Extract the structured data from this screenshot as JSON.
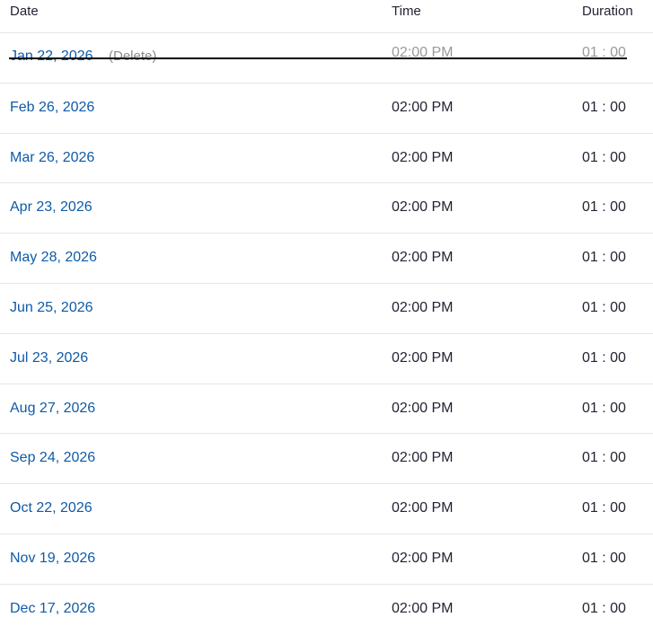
{
  "header": {
    "date": "Date",
    "time": "Time",
    "duration": "Duration"
  },
  "deleted_row": {
    "date": "Jan 22, 2026",
    "note": "(Delete)",
    "time": "02:00 PM",
    "duration": "01 : 00"
  },
  "rows": [
    {
      "date": "Feb 26, 2026",
      "time": "02:00 PM",
      "duration": "01 : 00"
    },
    {
      "date": "Mar 26, 2026",
      "time": "02:00 PM",
      "duration": "01 : 00"
    },
    {
      "date": "Apr 23, 2026",
      "time": "02:00 PM",
      "duration": "01 : 00"
    },
    {
      "date": "May 28, 2026",
      "time": "02:00 PM",
      "duration": "01 : 00"
    },
    {
      "date": "Jun 25, 2026",
      "time": "02:00 PM",
      "duration": "01 : 00"
    },
    {
      "date": "Jul 23, 2026",
      "time": "02:00 PM",
      "duration": "01 : 00"
    },
    {
      "date": "Aug 27, 2026",
      "time": "02:00 PM",
      "duration": "01 : 00"
    },
    {
      "date": "Sep 24, 2026",
      "time": "02:00 PM",
      "duration": "01 : 00"
    },
    {
      "date": "Oct 22, 2026",
      "time": "02:00 PM",
      "duration": "01 : 00"
    },
    {
      "date": "Nov 19, 2026",
      "time": "02:00 PM",
      "duration": "01 : 00"
    },
    {
      "date": "Dec 17, 2026",
      "time": "02:00 PM",
      "duration": "01 : 00"
    }
  ],
  "colors": {
    "link": "#0e5ba8",
    "text": "#232333",
    "muted": "#8a8a8a",
    "divider": "#e6e6e6"
  }
}
